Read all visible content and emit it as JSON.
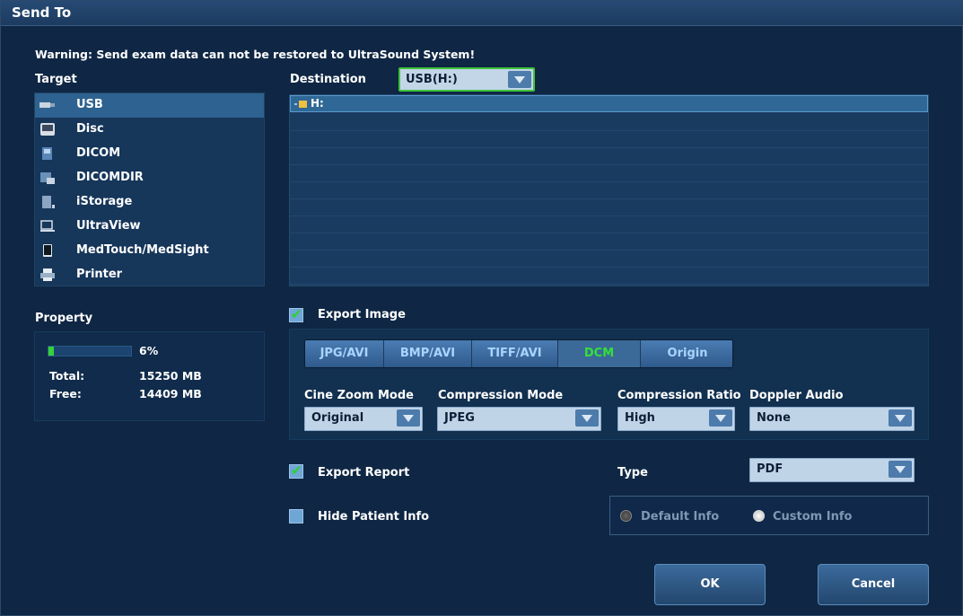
{
  "window": {
    "title": "Send To"
  },
  "warning": "Warning: Send exam data can not be restored to UltraSound System!",
  "target": {
    "label": "Target",
    "items": [
      {
        "label": "USB",
        "icon": "usb-drive-icon",
        "selected": true
      },
      {
        "label": "Disc",
        "icon": "disc-icon",
        "selected": false
      },
      {
        "label": "DICOM",
        "icon": "dicom-icon",
        "selected": false
      },
      {
        "label": "DICOMDIR",
        "icon": "dicomdir-icon",
        "selected": false
      },
      {
        "label": "iStorage",
        "icon": "istorage-icon",
        "selected": false
      },
      {
        "label": "UltraView",
        "icon": "ultraview-icon",
        "selected": false
      },
      {
        "label": "MedTouch/MedSight",
        "icon": "tablet-icon",
        "selected": false
      },
      {
        "label": "Printer",
        "icon": "printer-icon",
        "selected": false
      }
    ]
  },
  "destination": {
    "label": "Destination",
    "selected": "USB(H:)",
    "items": [
      {
        "label": "H:",
        "icon": "folder-icon",
        "selected": true
      }
    ]
  },
  "property": {
    "label": "Property",
    "usage_percent": 6,
    "usage_text": "6%",
    "total_label": "Total:",
    "total_value": "15250 MB",
    "free_label": "Free:",
    "free_value": "14409 MB"
  },
  "export_image": {
    "label": "Export Image",
    "checked": true,
    "formats": [
      {
        "label": "JPG/AVI",
        "active": false
      },
      {
        "label": "BMP/AVI",
        "active": false
      },
      {
        "label": "TIFF/AVI",
        "active": false
      },
      {
        "label": "DCM",
        "active": true
      },
      {
        "label": "Origin",
        "active": false
      }
    ],
    "cine_zoom_mode": {
      "label": "Cine Zoom Mode",
      "value": "Original"
    },
    "compression_mode": {
      "label": "Compression Mode",
      "value": "JPEG"
    },
    "compression_ratio": {
      "label": "Compression Ratio",
      "value": "High"
    },
    "doppler_audio": {
      "label": "Doppler Audio",
      "value": "None"
    }
  },
  "export_report": {
    "label": "Export Report",
    "checked": true,
    "type_label": "Type",
    "type_value": "PDF"
  },
  "hide_patient_info": {
    "label": "Hide Patient Info",
    "checked": false,
    "default_info": "Default Info",
    "custom_info": "Custom Info"
  },
  "buttons": {
    "ok": "OK",
    "cancel": "Cancel"
  },
  "colors": {
    "accent_green": "#35d23a",
    "selected_row": "#2e6290",
    "background": "#0f2744"
  }
}
